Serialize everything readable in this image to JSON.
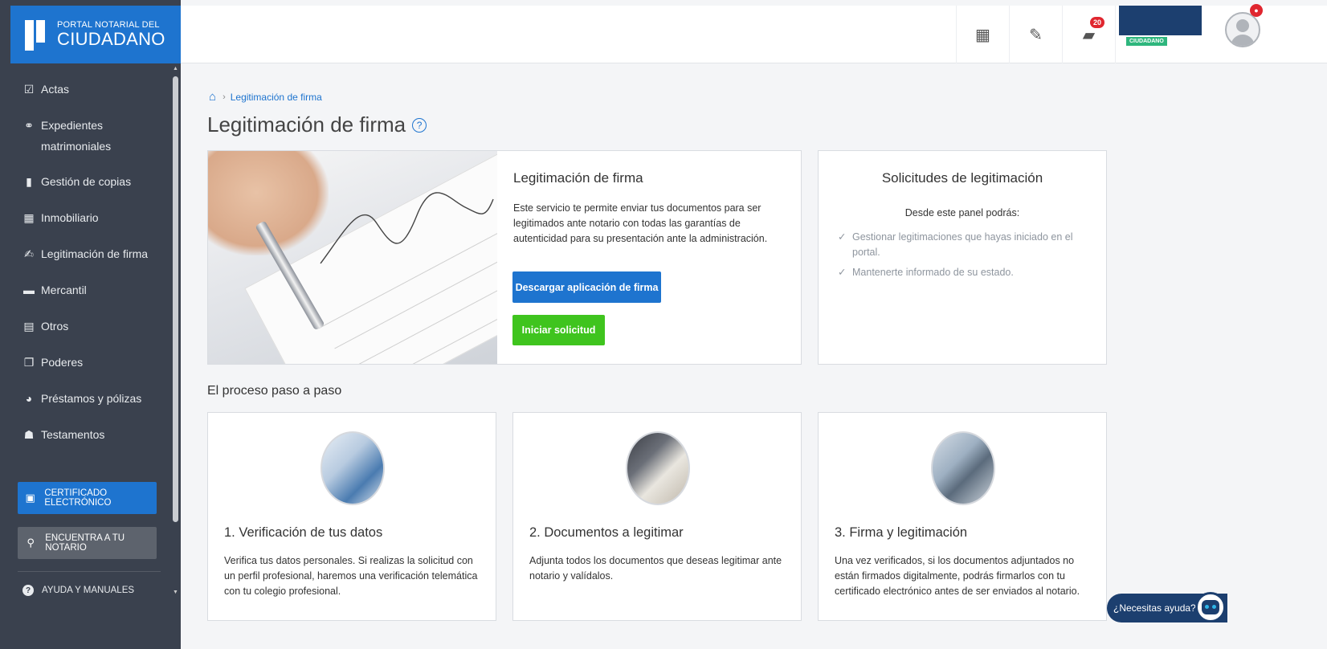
{
  "logo": {
    "line1": "PORTAL NOTARIAL DEL",
    "line2": "CIUDADANO"
  },
  "sidebar": {
    "items": [
      {
        "label": "Actas",
        "icon": "clipboard-check-icon",
        "glyph": "☑"
      },
      {
        "label": "Expedientes matrimoniales",
        "icon": "rings-icon",
        "glyph": "⚭"
      },
      {
        "label": "Gestión de copias",
        "icon": "file-icon",
        "glyph": "▮"
      },
      {
        "label": "Inmobiliario",
        "icon": "building-icon",
        "glyph": "▦"
      },
      {
        "label": "Legitimación de firma",
        "icon": "signature-icon",
        "glyph": "✍"
      },
      {
        "label": "Mercantil",
        "icon": "briefcase-icon",
        "glyph": "▬"
      },
      {
        "label": "Otros",
        "icon": "archive-box-icon",
        "glyph": "▤"
      },
      {
        "label": "Poderes",
        "icon": "documents-icon",
        "glyph": "❐"
      },
      {
        "label": "Préstamos y pólizas",
        "icon": "hand-coin-icon",
        "glyph": "◕"
      },
      {
        "label": "Testamentos",
        "icon": "people-icon",
        "glyph": "☗"
      }
    ],
    "cert_button": "CERTIFICADO ELECTRÓNICO",
    "find_notary_button": "ENCUENTRA A TU NOTARIO",
    "help_link": "AYUDA Y MANUALES"
  },
  "topbar": {
    "notifications_count": "20",
    "user_tag": "CIUDADANO"
  },
  "breadcrumb": {
    "current": "Legitimación de firma"
  },
  "page": {
    "title": "Legitimación de firma"
  },
  "main_card": {
    "title": "Legitimación de firma",
    "description": "Este servicio te permite enviar tus documentos para ser legitimados ante notario con todas las garantías de autenticidad para su presentación ante la administración.",
    "download_button": "Descargar aplicación de firma",
    "start_button": "Iniciar solicitud"
  },
  "side_card": {
    "title": "Solicitudes de legitimación",
    "subtitle": "Desde este panel podrás:",
    "items": [
      "Gestionar legitimaciones que hayas iniciado en el portal.",
      "Mantenerte informado de su estado."
    ]
  },
  "process": {
    "title": "El proceso paso a paso",
    "steps": [
      {
        "title": "1. Verificación de tus datos",
        "text": "Verifica tus datos personales. Si realizas la solicitud con un perfil profesional, haremos una verificación telemática con tu colegio profesional."
      },
      {
        "title": "2. Documentos a legitimar",
        "text": "Adjunta todos los documentos que deseas legitimar ante notario y valídalos."
      },
      {
        "title": "3. Firma y legitimación",
        "text": "Una vez verificados, si los documentos adjuntados no están firmados digitalmente, podrás firmarlos con tu certificado electrónico antes de ser enviados al notario."
      }
    ]
  },
  "help_chat": {
    "label": "¿Necesitas ayuda?"
  },
  "colors": {
    "brand_blue": "#1e74cf",
    "sidebar_bg": "#3a414e",
    "success_green": "#3fc41e",
    "badge_red": "#e0262f",
    "navy": "#1c3f6f"
  }
}
